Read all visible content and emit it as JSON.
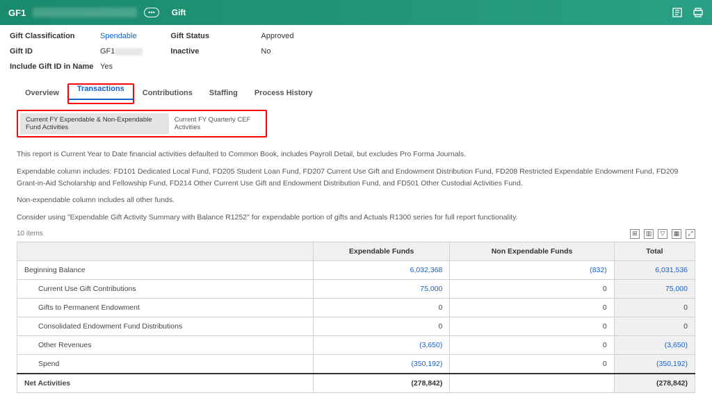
{
  "topbar": {
    "title_prefix": "GF1",
    "secondary": "Gift"
  },
  "meta": {
    "left": [
      {
        "label": "Gift Classification",
        "value": "Spendable",
        "link": true
      },
      {
        "label": "Gift ID",
        "value": "GF1",
        "blur": true
      },
      {
        "label": "Include Gift ID in Name",
        "value": "Yes"
      }
    ],
    "right": [
      {
        "label": "Gift Status",
        "value": "Approved"
      },
      {
        "label": "Inactive",
        "value": "No"
      }
    ]
  },
  "tabs": [
    "Overview",
    "Transactions",
    "Contributions",
    "Staffing",
    "Process History"
  ],
  "active_tab": "Transactions",
  "subtabs": [
    "Current FY Expendable & Non-Expendable Fund Activities",
    "Current FY Quarterly CEF Activities"
  ],
  "active_subtab": 0,
  "desc": {
    "p1": "This report is Current Year to Date financial activities defaulted to Common Book, includes Payroll Detail, but excludes Pro Forma Journals.",
    "p2": "Expendable column includes: FD101 Dedicated Local Fund, FD205 Student Loan Fund, FD207 Current Use Gift and Endowment Distribution Fund, FD208 Restricted Expendable Endowment Fund, FD209 Grant-in-Aid Scholarship and Fellowship Fund, FD214 Other Current Use Gift and Endowment Distribution Fund, and FD501 Other Custodial Activities Fund.",
    "p3": "Non-expendable column includes all other funds.",
    "p4": "Consider using \"Expendable Gift Activity Summary with Balance R1252\" for expendable portion of gifts and Actuals R1300 series for full report functionality."
  },
  "table": {
    "count": "10 items",
    "columns": [
      "",
      "Expendable Funds",
      "Non Expendable Funds",
      "Total"
    ],
    "rows": [
      {
        "label": "Beginning Balance",
        "vals": [
          "6,032,368",
          "(832)",
          "6,031,536"
        ],
        "links": [
          true,
          true,
          true
        ]
      },
      {
        "label": "Current Use Gift Contributions",
        "vals": [
          "75,000",
          "0",
          "75,000"
        ],
        "links": [
          true,
          false,
          true
        ],
        "indent": true
      },
      {
        "label": "Gifts to Permanent Endowment",
        "vals": [
          "0",
          "0",
          "0"
        ],
        "links": [
          false,
          false,
          false
        ],
        "indent": true
      },
      {
        "label": "Consolidated Endowment Fund Distributions",
        "vals": [
          "0",
          "0",
          "0"
        ],
        "links": [
          false,
          false,
          false
        ],
        "indent": true
      },
      {
        "label": "Other Revenues",
        "vals": [
          "(3,650)",
          "0",
          "(3,650)"
        ],
        "links": [
          true,
          false,
          true
        ],
        "indent": true
      },
      {
        "label": "Spend",
        "vals": [
          "(350,192)",
          "0",
          "(350,192)"
        ],
        "links": [
          true,
          false,
          true
        ],
        "indent": true
      },
      {
        "label": "Net Activities",
        "vals": [
          "(278,842)",
          "",
          "(278,842)"
        ],
        "links": [
          false,
          false,
          false
        ],
        "net": true
      }
    ]
  }
}
